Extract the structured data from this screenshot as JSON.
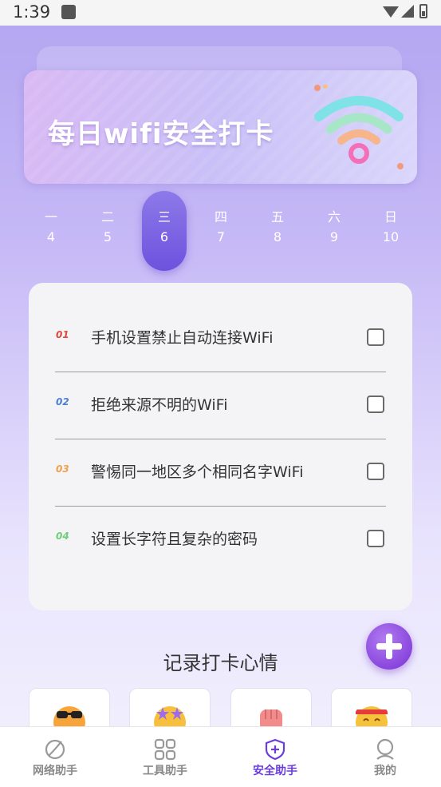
{
  "status_bar": {
    "time": "1:39"
  },
  "banner": {
    "title": "每日wifi安全打卡"
  },
  "week": {
    "days": [
      {
        "weekday": "一",
        "date": "4"
      },
      {
        "weekday": "二",
        "date": "5"
      },
      {
        "weekday": "三",
        "date": "6",
        "selected": true
      },
      {
        "weekday": "四",
        "date": "7"
      },
      {
        "weekday": "五",
        "date": "8"
      },
      {
        "weekday": "六",
        "date": "9"
      },
      {
        "weekday": "日",
        "date": "10"
      }
    ]
  },
  "checklist": {
    "items": [
      {
        "index": "01",
        "text": "手机设置禁止自动连接WiFi",
        "checked": false,
        "color": "#e0473f"
      },
      {
        "index": "02",
        "text": "拒绝来源不明的WiFi",
        "checked": false,
        "color": "#4a7fd8"
      },
      {
        "index": "03",
        "text": "警惕同一地区多个相同名字WiFi",
        "checked": false,
        "color": "#f0a050"
      },
      {
        "index": "04",
        "text": "设置长字符且复杂的密码",
        "checked": false,
        "color": "#6dcf7a"
      }
    ]
  },
  "mood": {
    "title": "记录打卡心情",
    "icons": [
      "cool-sunglasses-face-icon",
      "star-eyes-face-icon",
      "fist-icon",
      "headband-face-icon"
    ]
  },
  "nav": {
    "items": [
      {
        "label": "网络助手",
        "icon": "leaf-icon"
      },
      {
        "label": "工具助手",
        "icon": "grid-icon"
      },
      {
        "label": "安全助手",
        "icon": "shield-plus-icon",
        "active": true
      },
      {
        "label": "我的",
        "icon": "user-icon"
      }
    ]
  },
  "colors": {
    "accent": "#6a3ddc",
    "background_top": "#b3a5f0"
  }
}
